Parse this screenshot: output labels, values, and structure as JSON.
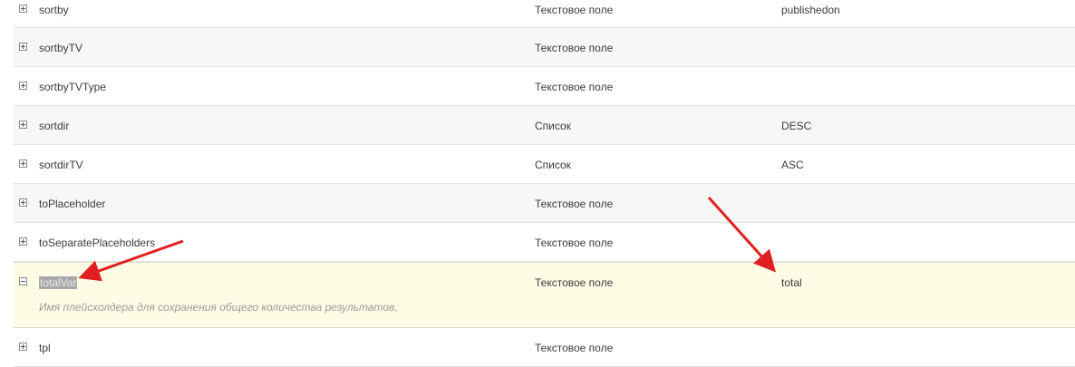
{
  "rows": [
    {
      "name": "sortby",
      "type": "Текстовое поле",
      "value": "publishedon"
    },
    {
      "name": "sortbyTV",
      "type": "Текстовое поле",
      "value": ""
    },
    {
      "name": "sortbyTVType",
      "type": "Текстовое поле",
      "value": ""
    },
    {
      "name": "sortdir",
      "type": "Список",
      "value": "DESC"
    },
    {
      "name": "sortdirTV",
      "type": "Список",
      "value": "ASC"
    },
    {
      "name": "toPlaceholder",
      "type": "Текстовое поле",
      "value": ""
    },
    {
      "name": "toSeparatePlaceholders",
      "type": "Текстовое поле",
      "value": ""
    },
    {
      "name": "totalVar",
      "type": "Текстовое поле",
      "value": "total",
      "description": "Имя плейсхолдера для сохранения общего количества результатов."
    },
    {
      "name": "tpl",
      "type": "Текстовое поле",
      "value": ""
    }
  ],
  "colors": {
    "highlight_row": "#fdfde6",
    "alt_row": "#f7f7f7",
    "annotation_arrow": "#e02020"
  },
  "icons": {
    "collapsed": "plus-square-icon",
    "expanded": "minus-square-icon"
  }
}
